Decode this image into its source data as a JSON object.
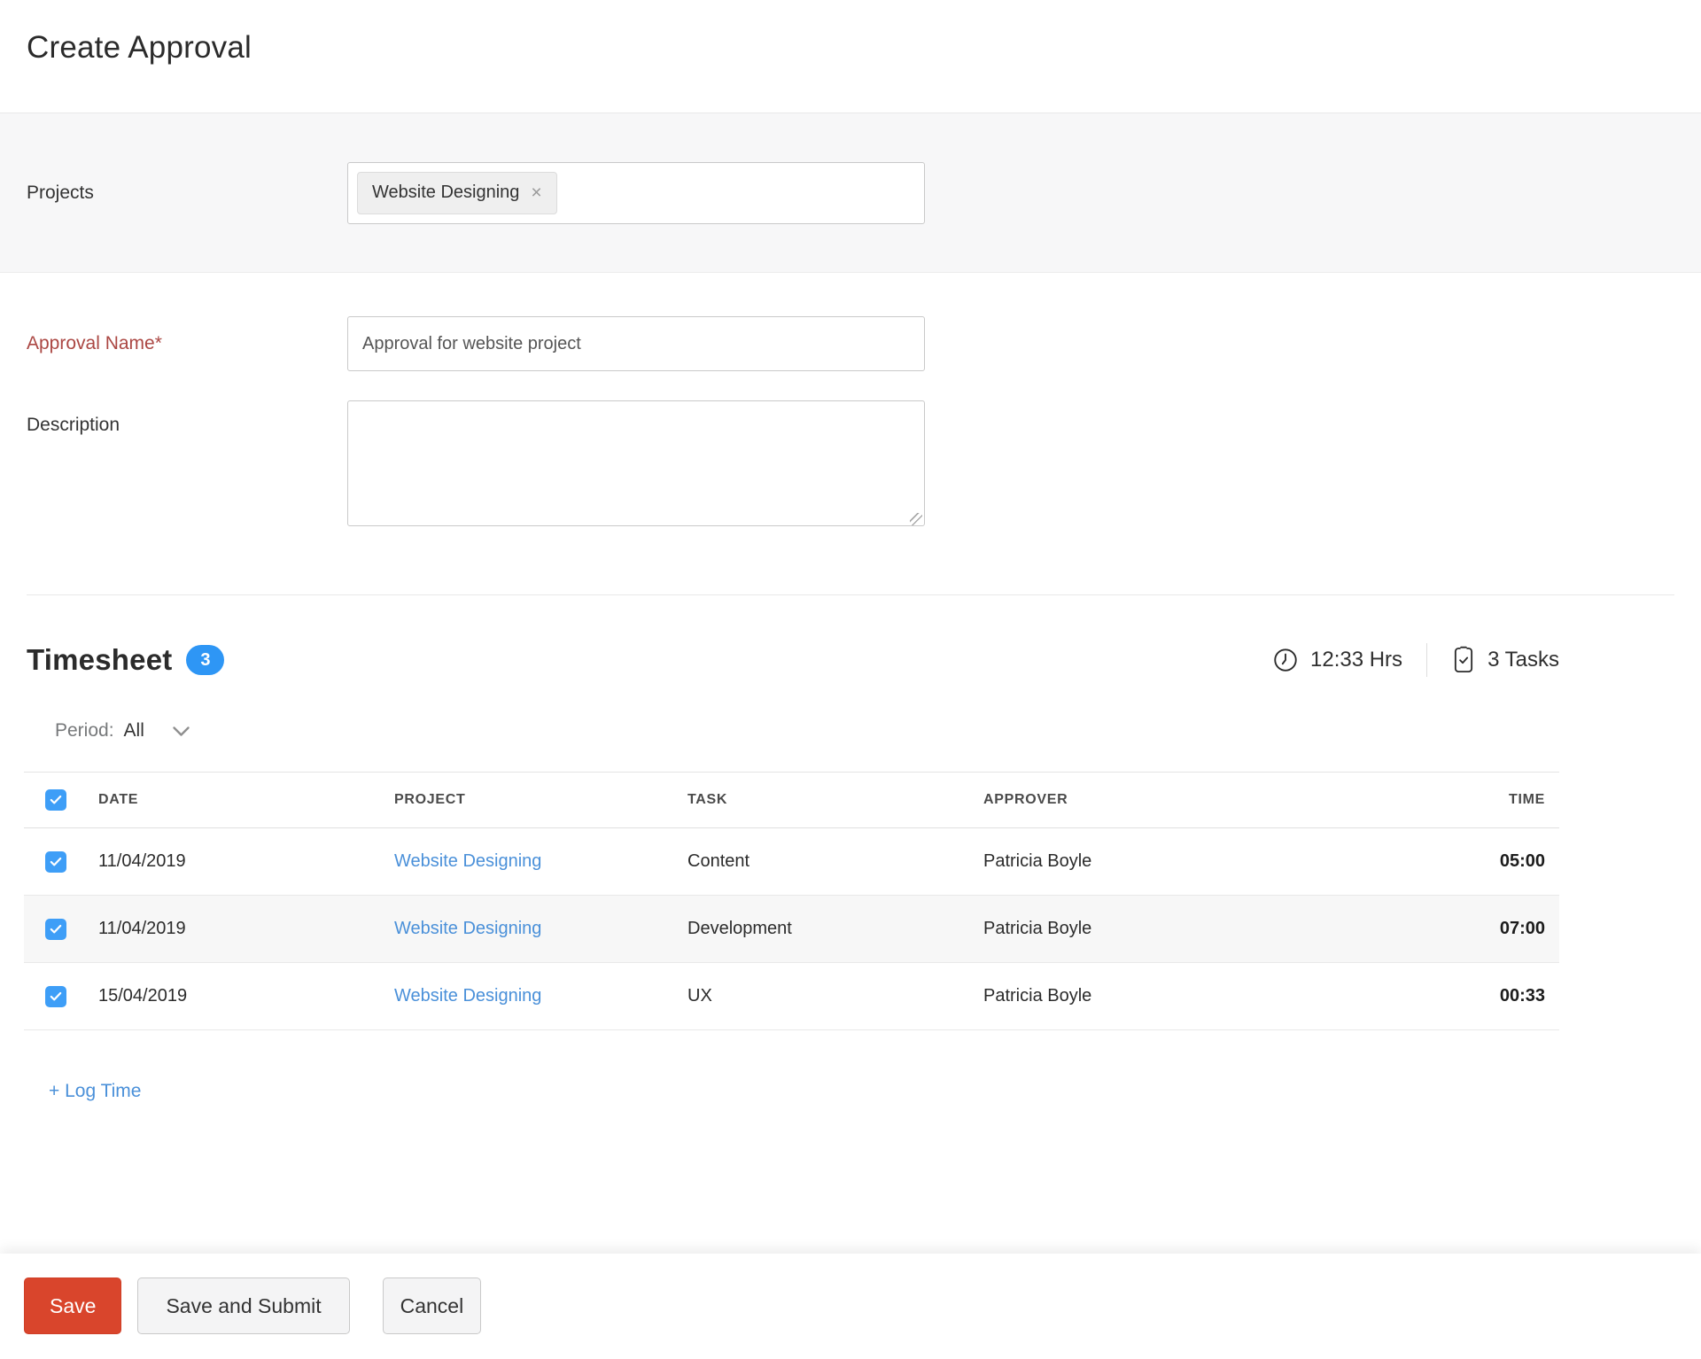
{
  "page": {
    "title": "Create Approval"
  },
  "form": {
    "projects": {
      "label": "Projects",
      "tags": [
        {
          "text": "Website Designing"
        }
      ]
    },
    "approval_name": {
      "label": "Approval Name*",
      "value": "Approval for website project"
    },
    "description": {
      "label": "Description",
      "value": ""
    }
  },
  "timesheet": {
    "title": "Timesheet",
    "count_badge": "3",
    "total_hours": "12:33 Hrs",
    "total_tasks": "3 Tasks",
    "period_label": "Period:",
    "period_value": "All",
    "table": {
      "headers": [
        "DATE",
        "PROJECT",
        "TASK",
        "APPROVER",
        "TIME"
      ],
      "header_checkbox_checked": true,
      "rows": [
        {
          "checked": true,
          "date": "11/04/2019",
          "project": "Website Designing",
          "task": "Content",
          "approver": "Patricia Boyle",
          "time": "05:00"
        },
        {
          "checked": true,
          "date": "11/04/2019",
          "project": "Website Designing",
          "task": "Development",
          "approver": "Patricia Boyle",
          "time": "07:00"
        },
        {
          "checked": true,
          "date": "15/04/2019",
          "project": "Website Designing",
          "task": "UX",
          "approver": "Patricia Boyle",
          "time": "00:33"
        }
      ]
    },
    "log_time_link": "+ Log Time"
  },
  "footer": {
    "save_label": "Save",
    "save_and_submit_label": "Save and Submit",
    "cancel_label": "Cancel"
  },
  "icons": {
    "remove_glyph": "×",
    "clock": "clock-icon",
    "tasks": "clipboard-check-icon",
    "chevron": "chevron-down-icon",
    "checkbox": "checkbox-checked-icon"
  },
  "colors": {
    "badge_blue": "#2e96f5",
    "checkbox_blue": "#3e9ef7",
    "link_blue": "#4a90d9",
    "required_red": "#ab4743",
    "save_red": "#d9452c"
  }
}
